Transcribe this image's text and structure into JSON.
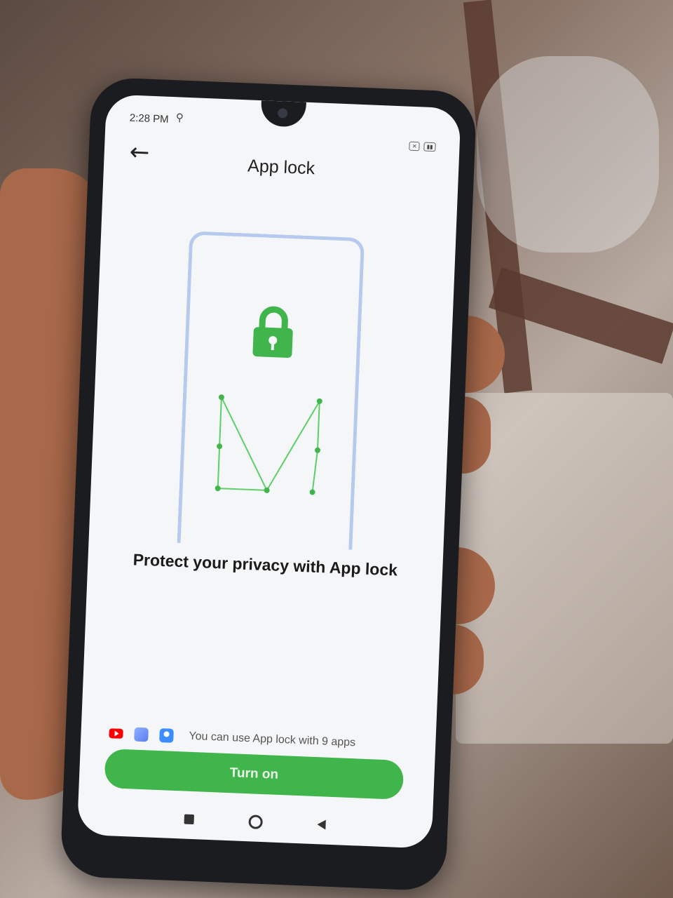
{
  "status_bar": {
    "time": "2:28 PM"
  },
  "header": {
    "title": "App lock"
  },
  "main": {
    "headline": "Protect your privacy with App lock",
    "apps_info": "You can use App lock with 9 apps",
    "button_label": "Turn on"
  },
  "icons": [
    "back-arrow-icon",
    "lock-icon",
    "youtube-icon",
    "gallery-icon",
    "contacts-icon"
  ],
  "colors": {
    "accent": "#3fb54c",
    "illustration_frame": "#b6c9ef"
  }
}
